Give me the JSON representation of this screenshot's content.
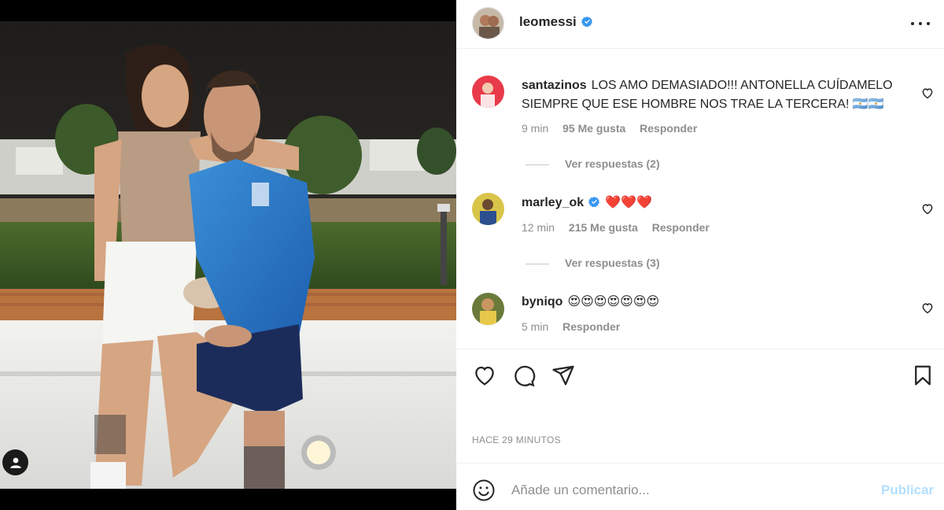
{
  "post": {
    "username": "leomessi",
    "verified": true,
    "timestamp": "HACE 29 MINUTOS"
  },
  "comments": [
    {
      "username": "santazinos",
      "text": "LOS AMO DEMASIADO!!! ANTONELLA CUÍDAMELO SIEMPRE QUE ESE HOMBRE NOS TRAE LA TERCERA! 🇦🇷🇦🇷",
      "time": "9 min",
      "likes": "95 Me gusta",
      "reply": "Responder",
      "view_replies": "Ver respuestas (2)"
    },
    {
      "username": "marley_ok",
      "verified": true,
      "text": "❤️❤️❤️",
      "time": "12 min",
      "likes": "215 Me gusta",
      "reply": "Responder",
      "view_replies": "Ver respuestas (3)"
    },
    {
      "username": "byniqo",
      "text": "😍😍😍😍😍😍😍",
      "time": "5 min",
      "reply": "Responder"
    }
  ],
  "add_comment": {
    "placeholder": "Añade un comentario...",
    "publish_label": "Publicar"
  },
  "icons": {
    "like": "heart-icon",
    "comment": "comment-icon",
    "share": "share-icon",
    "save": "bookmark-icon",
    "emoji": "emoji-icon",
    "options": "more-options-icon",
    "tagged": "user-tag-icon"
  },
  "colors": {
    "verified": "#3897f0",
    "publish_disabled": "#b2dffc",
    "meta_text": "#8e8e8e"
  }
}
